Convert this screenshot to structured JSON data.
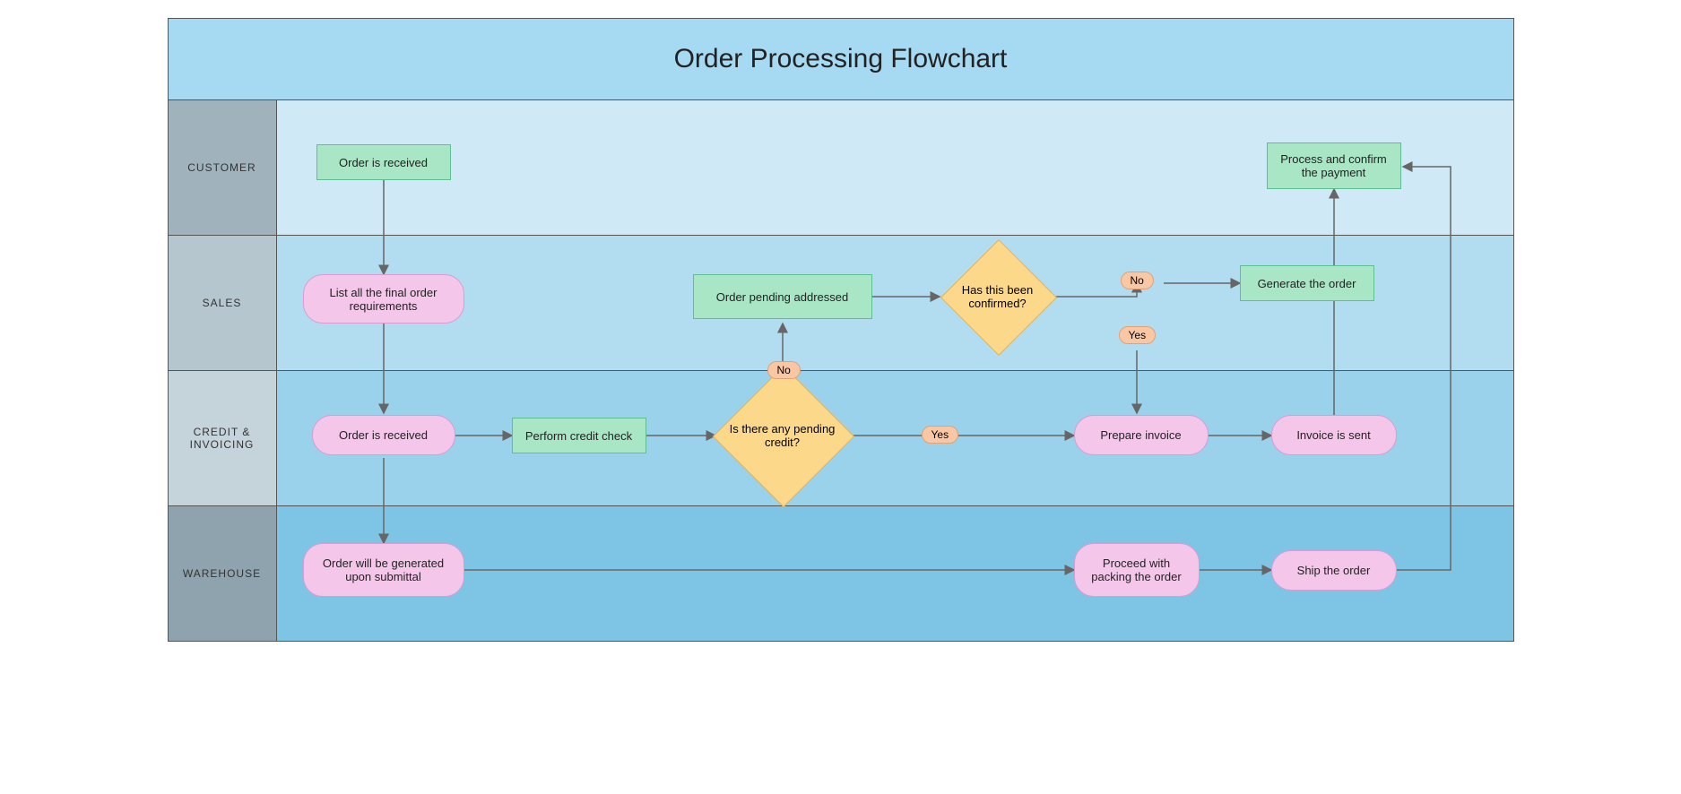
{
  "title": "Order Processing Flowchart",
  "lanes": {
    "customer": "CUSTOMER",
    "sales": "SALES",
    "credit": "CREDIT & INVOICING",
    "warehouse": "WAREHOUSE"
  },
  "nodes": {
    "order_received_cust": "Order is received",
    "list_reqs": "List all the final order requirements",
    "order_received_credit": "Order is received",
    "perform_credit": "Perform credit check",
    "pending_credit_q": "Is there any pending credit?",
    "order_pending_addr": "Order pending addressed",
    "confirmed_q": "Has this been confirmed?",
    "generate_order": "Generate the order",
    "prepare_invoice": "Prepare invoice",
    "invoice_sent": "Invoice is sent",
    "process_payment": "Process and confirm the payment",
    "order_gen_submittal": "Order will be generated upon submittal",
    "proceed_packing": "Proceed with packing the order",
    "ship_order": "Ship the order"
  },
  "labels": {
    "yes": "Yes",
    "no": "No"
  }
}
